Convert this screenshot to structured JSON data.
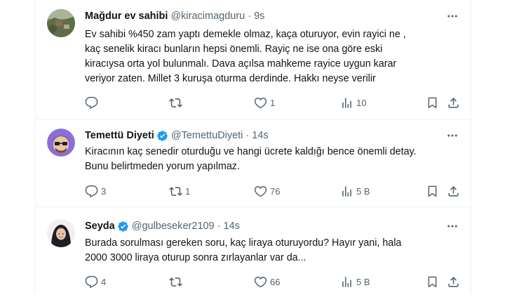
{
  "tweets": [
    {
      "name": "Mağdur ev sahibi",
      "verified": false,
      "handle": "@kiracimagduru",
      "time": "9s",
      "lines": [
        "Ev sahibi %450 zam yaptı demekle olmaz, kaça oturuyor, evin rayici ne ,",
        "kaç senelik kiracı bunların hepsi önemli. Rayiç ne ise ona göre eski",
        "kiracıysa orta yol bulunmalı. Dava açılsa mahkeme rayice uygun karar",
        "veriyor zaten. Millet 3 kuruşa oturma derdinde. Hakkı neyse verilir"
      ],
      "replies": "",
      "retweets": "",
      "likes": "1",
      "views": "10"
    },
    {
      "name": "Temettü Diyeti",
      "verified": true,
      "handle": "@TemettuDiyeti",
      "time": "14s",
      "lines": [
        "Kiracının kaç senedir oturduğu ve hangi ücrete kaldığı bence önemli detay.",
        "Bunu belirtmeden yorum yapılmaz."
      ],
      "replies": "3",
      "retweets": "1",
      "likes": "76",
      "views": "5 B"
    },
    {
      "name": "Seyda",
      "verified": true,
      "handle": "@gulbeseker2109",
      "time": "14s",
      "lines": [
        "Burada sorulması gereken soru, kaç liraya oturuyordu? Hayır yani, hala",
        "2000 3000 liraya oturup sonra zırlayanlar var da..."
      ],
      "replies": "4",
      "retweets": "",
      "likes": "66",
      "views": "5 B"
    }
  ],
  "colors": {
    "text": "#0f1419",
    "secondary": "#536471",
    "verified": "#1d9bf0",
    "divider": "#eff3f4"
  },
  "icons": [
    "reply-icon",
    "retweet-icon",
    "like-icon",
    "views-icon",
    "bookmark-icon",
    "share-icon",
    "more-icon",
    "verified-badge-icon"
  ]
}
